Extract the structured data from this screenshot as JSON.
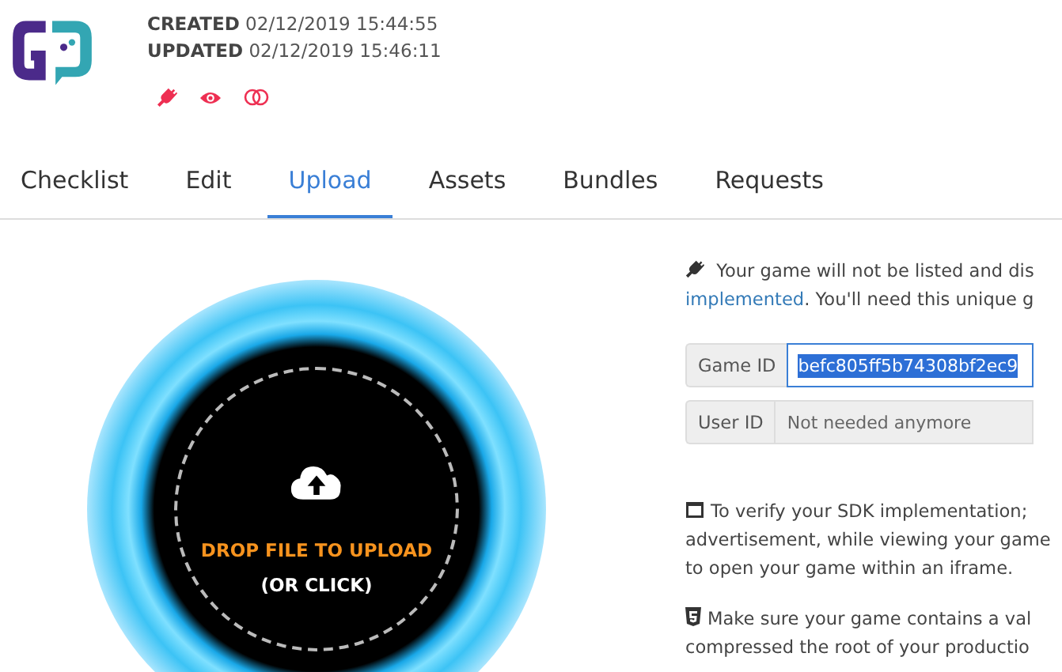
{
  "header": {
    "created_label": "CREATED",
    "created": "02/12/2019 15:44:55",
    "updated_label": "UPDATED",
    "updated": "02/12/2019 15:46:11"
  },
  "tabs": [
    {
      "label": "Checklist",
      "selected": false
    },
    {
      "label": "Edit",
      "selected": false
    },
    {
      "label": "Upload",
      "selected": true
    },
    {
      "label": "Assets",
      "selected": false
    },
    {
      "label": "Bundles",
      "selected": false
    },
    {
      "label": "Requests",
      "selected": false
    }
  ],
  "upload": {
    "title": "DROP FILE TO UPLOAD",
    "subtitle": "(OR CLICK)"
  },
  "info": {
    "line_1": "Your game will not be listed and dis",
    "link": "implemented",
    "line_2": ". You'll need this unique g"
  },
  "fields": [
    {
      "label": "Game ID",
      "value": "befc805ff5b74308bf2ec9",
      "highlighted": true
    },
    {
      "label": "User ID",
      "placeholder": "Not needed anymore",
      "highlighted": false
    }
  ],
  "notes": [
    {
      "kind": "window",
      "lines": [
        "To verify your SDK implementation;",
        "advertisement, while viewing your game",
        "to open your game within an iframe."
      ]
    },
    {
      "kind": "html5",
      "lines": [
        "Make sure your game contains a val",
        "compressed the root of your productio"
      ]
    }
  ]
}
